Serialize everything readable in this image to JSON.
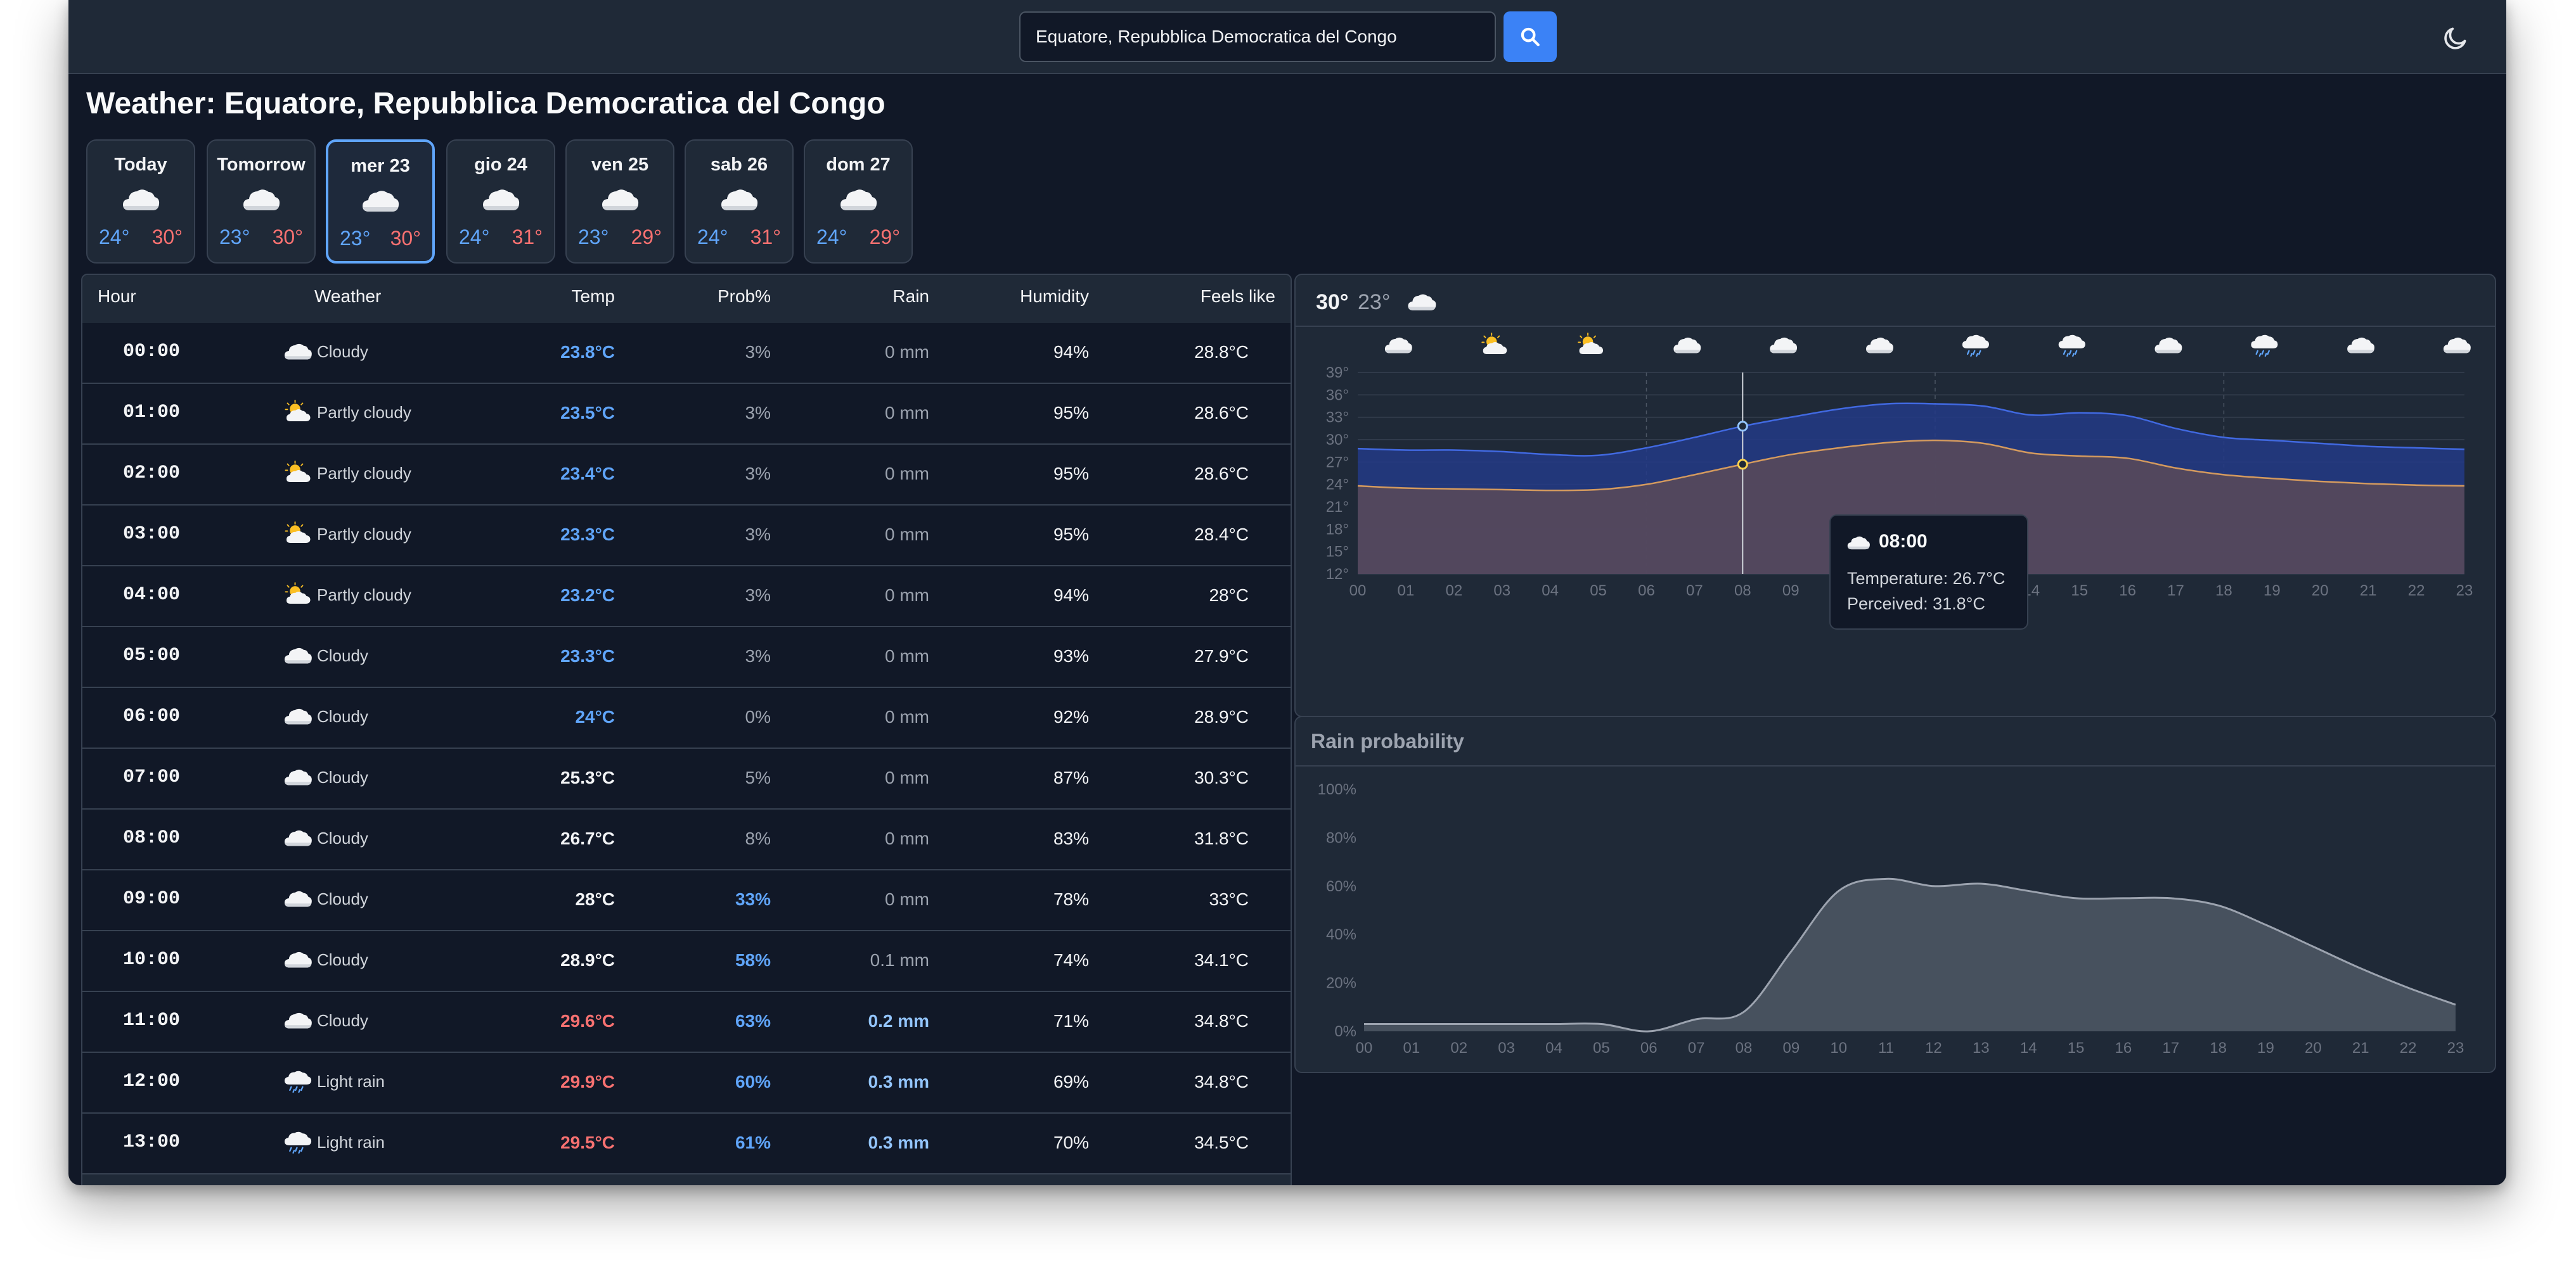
{
  "search": {
    "value": "Equatore, Repubblica Democratica del Congo"
  },
  "page_title": "Weather: Equatore, Repubblica Democratica del Congo",
  "days": [
    {
      "label": "Today",
      "min": "24°",
      "max": "30°",
      "icon": "cloud-icon",
      "selected": false
    },
    {
      "label": "Tomorrow",
      "min": "23°",
      "max": "30°",
      "icon": "cloud-icon",
      "selected": false
    },
    {
      "label": "mer 23",
      "min": "23°",
      "max": "30°",
      "icon": "cloud-icon",
      "selected": true
    },
    {
      "label": "gio 24",
      "min": "24°",
      "max": "31°",
      "icon": "cloud-icon",
      "selected": false
    },
    {
      "label": "ven 25",
      "min": "23°",
      "max": "29°",
      "icon": "cloud-icon",
      "selected": false
    },
    {
      "label": "sab 26",
      "min": "24°",
      "max": "31°",
      "icon": "cloud-icon",
      "selected": false
    },
    {
      "label": "dom 27",
      "min": "24°",
      "max": "29°",
      "icon": "cloud-icon",
      "selected": false
    }
  ],
  "table": {
    "headers": {
      "hour": "Hour",
      "weather": "Weather",
      "temp": "Temp",
      "prob": "Prob%",
      "rain": "Rain",
      "humidity": "Humidity",
      "feels": "Feels like"
    },
    "rows": [
      {
        "hour": "00:00",
        "icon": "cloud-icon",
        "desc": "Cloudy",
        "temp": "23.8°C",
        "prob": "3%",
        "rain": "0 mm",
        "humidity": "94%",
        "feels": "28.8°C"
      },
      {
        "hour": "01:00",
        "icon": "partly-cloudy-icon",
        "desc": "Partly cloudy",
        "temp": "23.5°C",
        "prob": "3%",
        "rain": "0 mm",
        "humidity": "95%",
        "feels": "28.6°C"
      },
      {
        "hour": "02:00",
        "icon": "partly-cloudy-icon",
        "desc": "Partly cloudy",
        "temp": "23.4°C",
        "prob": "3%",
        "rain": "0 mm",
        "humidity": "95%",
        "feels": "28.6°C"
      },
      {
        "hour": "03:00",
        "icon": "partly-cloudy-icon",
        "desc": "Partly cloudy",
        "temp": "23.3°C",
        "prob": "3%",
        "rain": "0 mm",
        "humidity": "95%",
        "feels": "28.4°C"
      },
      {
        "hour": "04:00",
        "icon": "partly-cloudy-icon",
        "desc": "Partly cloudy",
        "temp": "23.2°C",
        "prob": "3%",
        "rain": "0 mm",
        "humidity": "94%",
        "feels": "28°C"
      },
      {
        "hour": "05:00",
        "icon": "cloud-icon",
        "desc": "Cloudy",
        "temp": "23.3°C",
        "prob": "3%",
        "rain": "0 mm",
        "humidity": "93%",
        "feels": "27.9°C"
      },
      {
        "hour": "06:00",
        "icon": "cloud-icon",
        "desc": "Cloudy",
        "temp": "24°C",
        "prob": "0%",
        "rain": "0 mm",
        "humidity": "92%",
        "feels": "28.9°C"
      },
      {
        "hour": "07:00",
        "icon": "cloud-icon",
        "desc": "Cloudy",
        "temp": "25.3°C",
        "prob": "5%",
        "rain": "0 mm",
        "humidity": "87%",
        "feels": "30.3°C"
      },
      {
        "hour": "08:00",
        "icon": "cloud-icon",
        "desc": "Cloudy",
        "temp": "26.7°C",
        "prob": "8%",
        "rain": "0 mm",
        "humidity": "83%",
        "feels": "31.8°C"
      },
      {
        "hour": "09:00",
        "icon": "cloud-icon",
        "desc": "Cloudy",
        "temp": "28°C",
        "prob": "33%",
        "rain": "0 mm",
        "humidity": "78%",
        "feels": "33°C"
      },
      {
        "hour": "10:00",
        "icon": "cloud-icon",
        "desc": "Cloudy",
        "temp": "28.9°C",
        "prob": "58%",
        "rain": "0.1 mm",
        "humidity": "74%",
        "feels": "34.1°C"
      },
      {
        "hour": "11:00",
        "icon": "cloud-icon",
        "desc": "Cloudy",
        "temp": "29.6°C",
        "prob": "63%",
        "rain": "0.2 mm",
        "humidity": "71%",
        "feels": "34.8°C"
      },
      {
        "hour": "12:00",
        "icon": "light-rain-icon",
        "desc": "Light rain",
        "temp": "29.9°C",
        "prob": "60%",
        "rain": "0.3 mm",
        "humidity": "69%",
        "feels": "34.8°C"
      },
      {
        "hour": "13:00",
        "icon": "light-rain-icon",
        "desc": "Light rain",
        "temp": "29.5°C",
        "prob": "61%",
        "rain": "0.3 mm",
        "humidity": "70%",
        "feels": "34.5°C"
      }
    ]
  },
  "temp_chart_header": {
    "max": "30°",
    "min": "23°",
    "icon": "cloud-icon"
  },
  "chart_icons": [
    "cloud-icon",
    "partly-cloudy-icon",
    "partly-cloudy-icon",
    "cloud-icon",
    "cloud-icon",
    "cloud-icon",
    "light-rain-icon",
    "light-rain-icon",
    "cloud-icon",
    "light-rain-icon",
    "cloud-icon",
    "cloud-icon"
  ],
  "rain_title": "Rain probability",
  "tooltip": {
    "hour": "08:00",
    "temperature": "Temperature: 26.7°C",
    "perceived": "Perceived: 31.8°C",
    "icon": "cloud-icon"
  },
  "colors": {
    "background": "#111827",
    "panel": "#1f2937",
    "accent": "#3b82f6",
    "cold": "#60a5fa",
    "hot": "#f87171",
    "perceived_fill": "#233a86",
    "temp_line": "#d49a5e"
  },
  "chart_data": [
    {
      "type": "area",
      "x": [
        "00",
        "01",
        "02",
        "03",
        "04",
        "05",
        "06",
        "07",
        "08",
        "09",
        "10",
        "11",
        "12",
        "13",
        "14",
        "15",
        "16",
        "17",
        "18",
        "19",
        "20",
        "21",
        "22",
        "23"
      ],
      "yticks": [
        "39°",
        "36°",
        "33°",
        "30°",
        "27°",
        "24°",
        "21°",
        "18°",
        "15°",
        "12°"
      ],
      "ylim": [
        12,
        39
      ],
      "series": [
        {
          "values": [
            28.8,
            28.6,
            28.6,
            28.4,
            28,
            27.9,
            28.9,
            30.3,
            31.8,
            33,
            34.1,
            34.8,
            34.8,
            34.5,
            33.3,
            33.6,
            33.2,
            31.5,
            30.3,
            29.9,
            29.5,
            29.1,
            28.9,
            28.7
          ]
        },
        {
          "values": [
            23.8,
            23.5,
            23.4,
            23.3,
            23.2,
            23.3,
            24,
            25.3,
            26.7,
            28,
            28.9,
            29.6,
            29.9,
            29.5,
            28.2,
            27.8,
            27.5,
            26.2,
            25.3,
            24.8,
            24.4,
            24.1,
            23.9,
            23.8
          ]
        }
      ]
    },
    {
      "type": "area",
      "title": "Rain probability",
      "x": [
        "00",
        "01",
        "02",
        "03",
        "04",
        "05",
        "06",
        "07",
        "08",
        "09",
        "10",
        "11",
        "12",
        "13",
        "14",
        "15",
        "16",
        "17",
        "18",
        "19",
        "20",
        "21",
        "22",
        "23"
      ],
      "yticks": [
        "100%",
        "80%",
        "60%",
        "40%",
        "20%",
        "0%"
      ],
      "ylim": [
        0,
        100
      ],
      "values": [
        3,
        3,
        3,
        3,
        3,
        3,
        0,
        5,
        8,
        33,
        58,
        63,
        60,
        61,
        58,
        55,
        55,
        55,
        52,
        44,
        35,
        26,
        18,
        11
      ]
    }
  ]
}
